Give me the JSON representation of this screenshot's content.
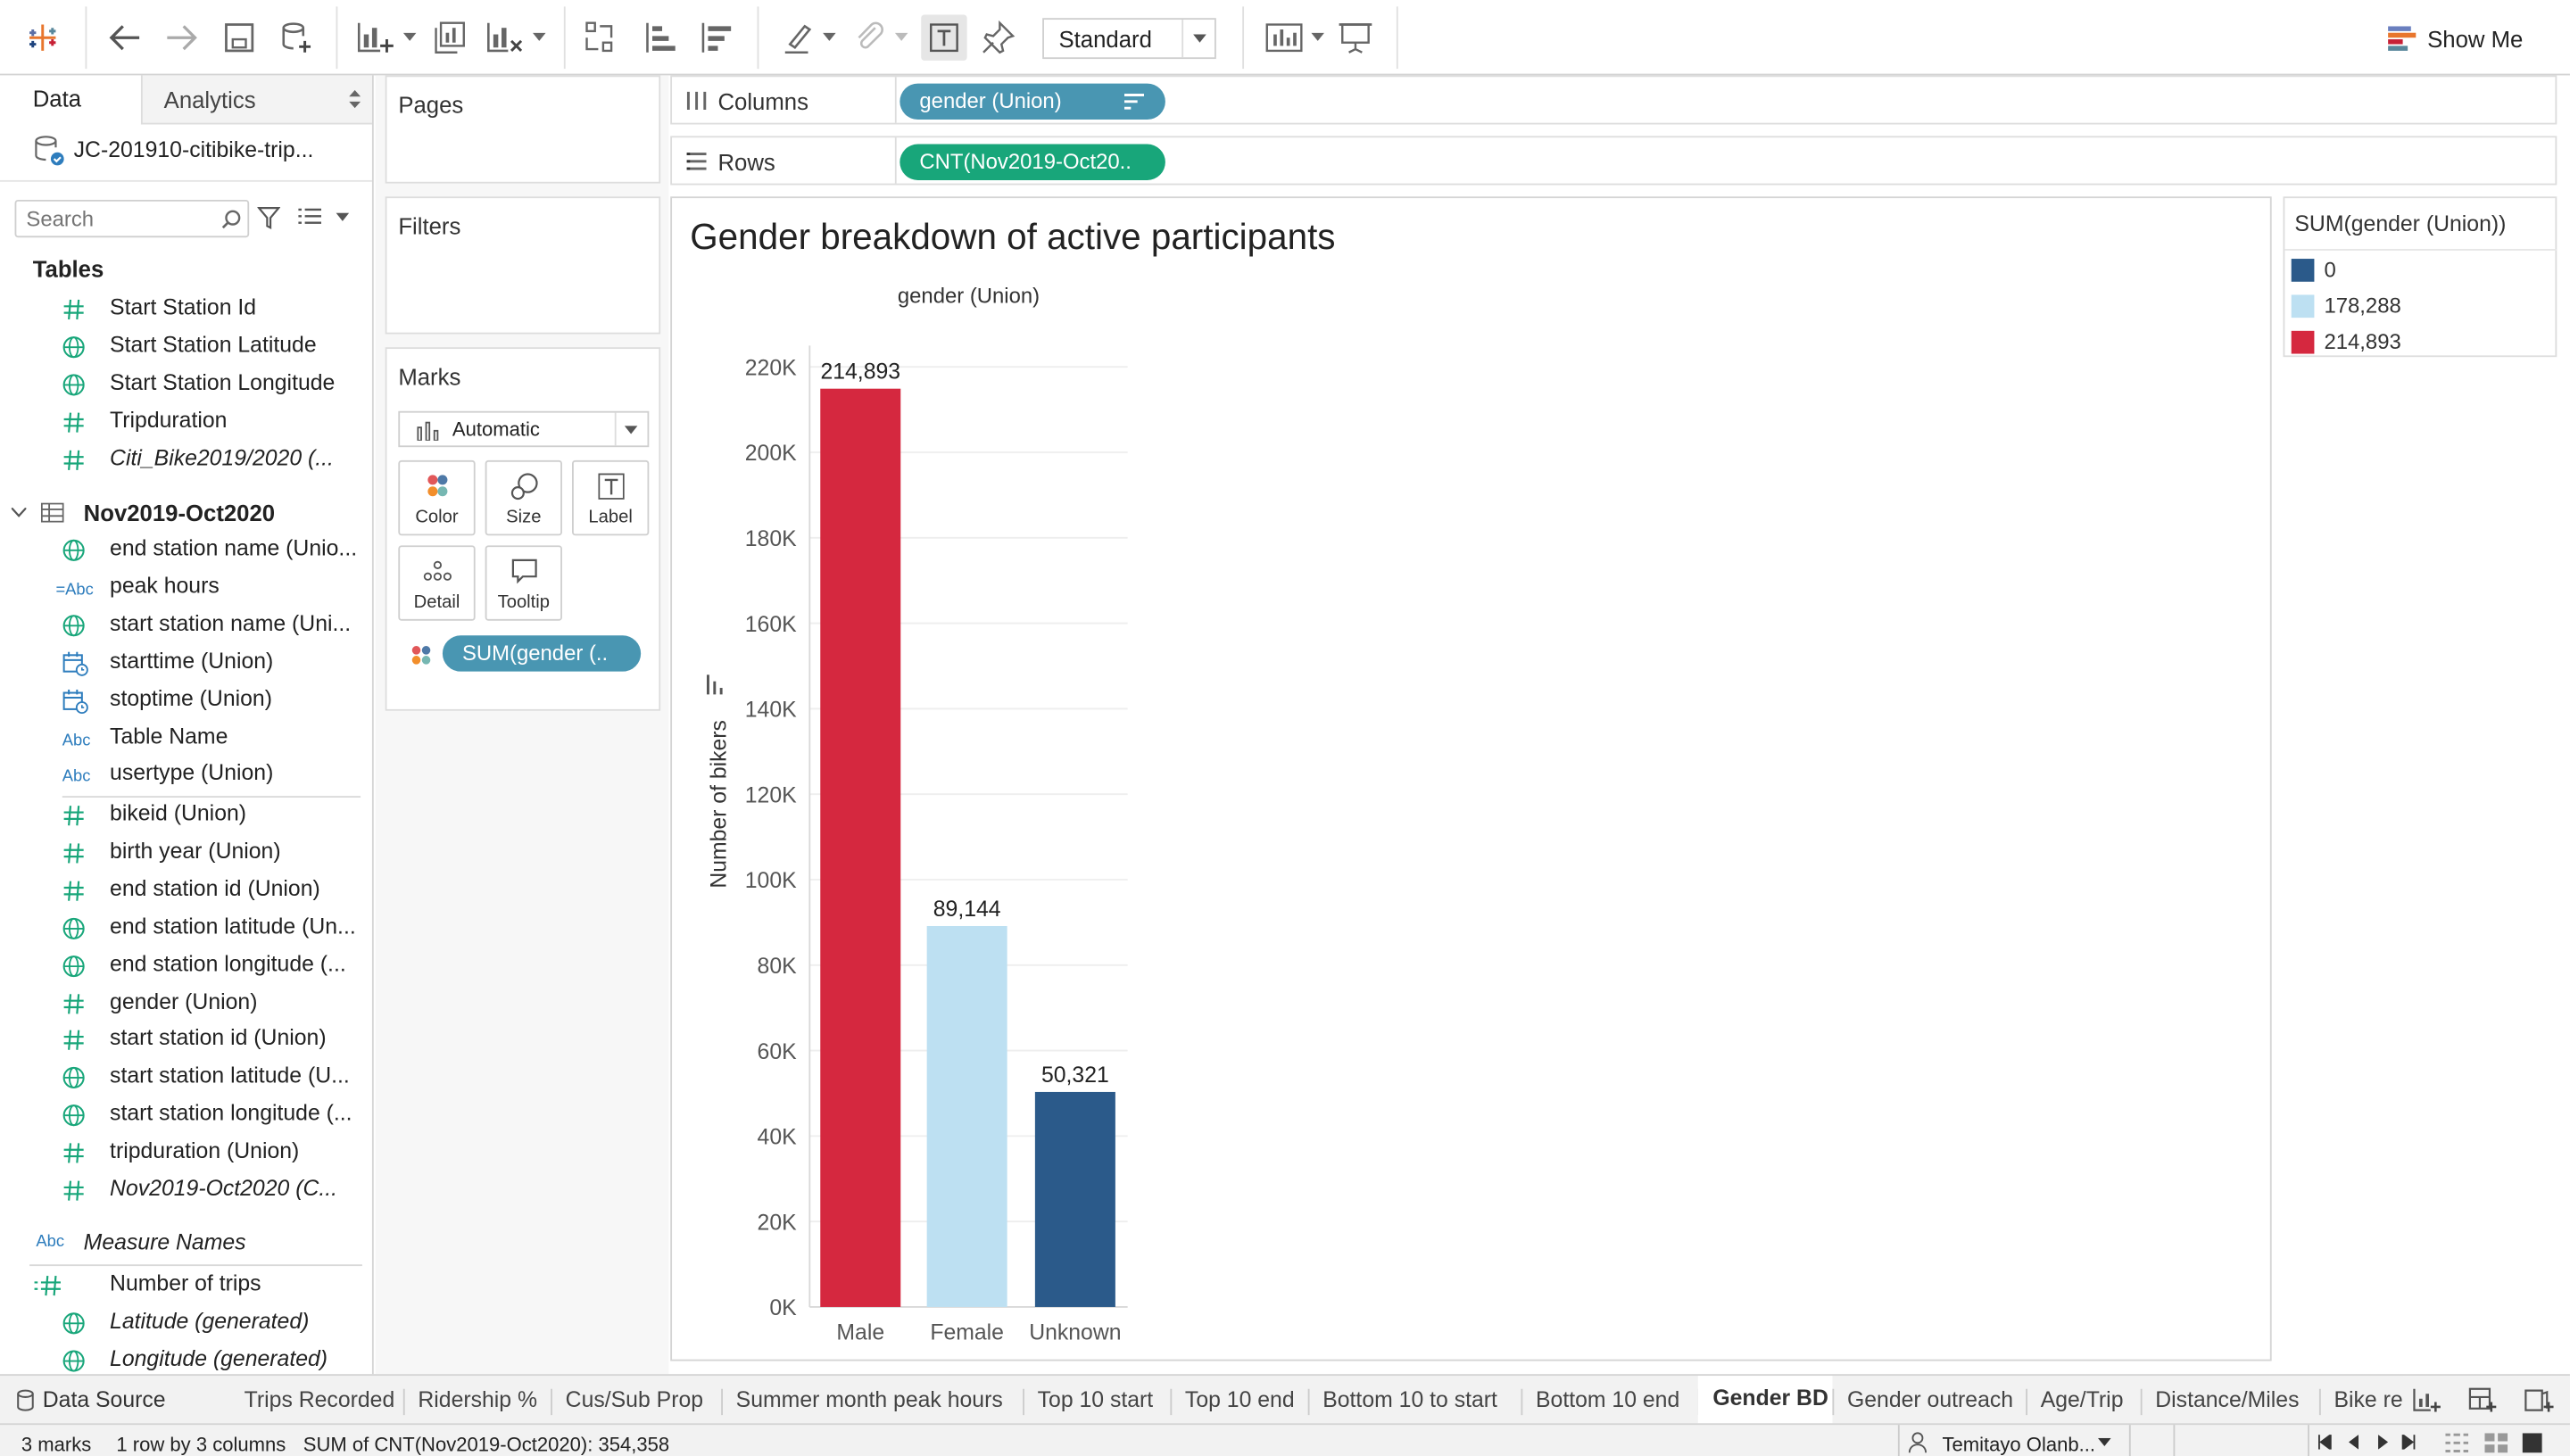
{
  "toolbar": {
    "dropdown_value": "Standard",
    "show_me_label": "Show Me"
  },
  "data_pane": {
    "tab_data": "Data",
    "tab_analytics": "Analytics",
    "datasource_name": "JC-201910-citibike-trip...",
    "search_placeholder": "Search",
    "tables_heading": "Tables",
    "fields_a": [
      {
        "label": "Start Station Id",
        "icon": "hash-icon",
        "italic": false
      },
      {
        "label": "Start Station Latitude",
        "icon": "globe-icon",
        "italic": false
      },
      {
        "label": "Start Station Longitude",
        "icon": "globe-icon",
        "italic": false
      },
      {
        "label": "Tripduration",
        "icon": "hash-icon",
        "italic": false
      },
      {
        "label": "Citi_Bike2019/2020 (...",
        "icon": "hash-icon",
        "italic": true
      }
    ],
    "table_name": "Nov2019-Oct2020",
    "fields_b": [
      {
        "label": "end station name (Unio...",
        "icon": "globe-icon",
        "italic": false
      },
      {
        "label": "peak hours",
        "icon": "abc-calc-icon",
        "italic": false
      },
      {
        "label": "start station name (Uni...",
        "icon": "globe-icon",
        "italic": false
      },
      {
        "label": "starttime (Union)",
        "icon": "calendar-icon",
        "italic": false
      },
      {
        "label": "stoptime (Union)",
        "icon": "calendar-icon",
        "italic": false
      },
      {
        "label": "Table Name",
        "icon": "abc-icon",
        "italic": false
      },
      {
        "label": "usertype (Union)",
        "icon": "abc-icon",
        "italic": false
      }
    ],
    "fields_c": [
      {
        "label": "bikeid (Union)",
        "icon": "hash-icon",
        "italic": false
      },
      {
        "label": "birth year (Union)",
        "icon": "hash-icon",
        "italic": false
      },
      {
        "label": "end station id (Union)",
        "icon": "hash-icon",
        "italic": false
      },
      {
        "label": "end station latitude (Un...",
        "icon": "globe-icon",
        "italic": false
      },
      {
        "label": "end station longitude (...",
        "icon": "globe-icon",
        "italic": false
      },
      {
        "label": "gender (Union)",
        "icon": "hash-icon",
        "italic": false
      },
      {
        "label": "start station id (Union)",
        "icon": "hash-icon",
        "italic": false
      },
      {
        "label": "start station latitude (U...",
        "icon": "globe-icon",
        "italic": false
      },
      {
        "label": "start station longitude (...",
        "icon": "globe-icon",
        "italic": false
      },
      {
        "label": "tripduration (Union)",
        "icon": "hash-icon",
        "italic": false
      },
      {
        "label": "Nov2019-Oct2020 (C...",
        "icon": "hash-icon",
        "italic": true
      }
    ],
    "measure_names": "Measure Names",
    "fields_d": [
      {
        "label": "Number of trips",
        "icon": "hash-calc-icon",
        "italic": false
      },
      {
        "label": "Latitude (generated)",
        "icon": "globe-icon",
        "italic": true
      },
      {
        "label": "Longitude (generated)",
        "icon": "globe-icon",
        "italic": true
      }
    ]
  },
  "cards": {
    "pages_title": "Pages",
    "filters_title": "Filters",
    "marks_title": "Marks",
    "mark_type": "Automatic",
    "color_label": "Color",
    "size_label": "Size",
    "label_label": "Label",
    "detail_label": "Detail",
    "tooltip_label": "Tooltip",
    "color_pill": "SUM(gender (.."
  },
  "shelves": {
    "columns_label": "Columns",
    "columns_pill": "gender (Union)",
    "rows_label": "Rows",
    "rows_pill": "CNT(Nov2019-Oct20.."
  },
  "legend": {
    "title": "SUM(gender (Union))",
    "items": [
      {
        "label": "0",
        "color": "#2b5a8a"
      },
      {
        "label": "178,288",
        "color": "#bde0f2"
      },
      {
        "label": "214,893",
        "color": "#d5283f"
      }
    ]
  },
  "chart_data": {
    "type": "bar",
    "title": "Gender breakdown of active participants",
    "column_header": "gender (Union)",
    "ylabel": "Number of bikers",
    "categories": [
      "Male",
      "Female",
      "Unknown"
    ],
    "values": [
      214893,
      89144,
      50321
    ],
    "value_labels": [
      "214,893",
      "89,144",
      "50,321"
    ],
    "colors": [
      "#d5283f",
      "#bde0f2",
      "#2b5a8a"
    ],
    "ylim": [
      0,
      220000
    ],
    "yticks": [
      0,
      20000,
      40000,
      60000,
      80000,
      100000,
      120000,
      140000,
      160000,
      180000,
      200000,
      220000
    ],
    "ytick_labels": [
      "0K",
      "20K",
      "40K",
      "60K",
      "80K",
      "100K",
      "120K",
      "140K",
      "160K",
      "180K",
      "200K",
      "220K"
    ],
    "grid": true
  },
  "sheet_tabs": {
    "data_source": "Data Source",
    "tabs": [
      "Trips Recorded",
      "Ridership %",
      "Cus/Sub Prop",
      "Summer month peak hours",
      "Top 10 start",
      "Top 10 end",
      "Bottom 10 to start",
      "Bottom 10 end",
      "Gender BD",
      "Gender outreach",
      "Age/Trip",
      "Distance/Miles",
      "Bike re"
    ],
    "active": "Gender BD"
  },
  "status_bar": {
    "marks": "3 marks",
    "dims": "1 row by 3 columns",
    "sum": "SUM of CNT(Nov2019-Oct2020): 354,358",
    "user": "Temitayo Olanb..."
  }
}
